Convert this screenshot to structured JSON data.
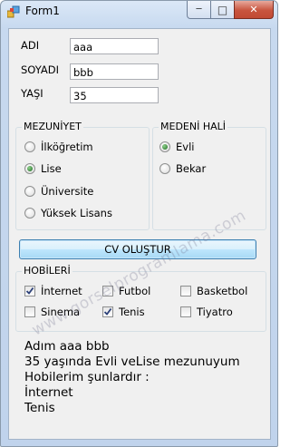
{
  "window": {
    "title": "Form1",
    "minimize_glyph": "─",
    "maximize_glyph": "□",
    "close_glyph": "✕"
  },
  "fields": {
    "adi": {
      "label": "ADI",
      "value": "aaa"
    },
    "soyadi": {
      "label": "SOYADI",
      "value": "bbb"
    },
    "yasi": {
      "label": "YAŞI",
      "value": "35"
    }
  },
  "mezuniyet": {
    "title": "MEZUNİYET",
    "options": [
      {
        "label": "İlköğretim",
        "selected": false
      },
      {
        "label": "Lise",
        "selected": true
      },
      {
        "label": "Üniversite",
        "selected": false
      },
      {
        "label": "Yüksek Lisans",
        "selected": false
      }
    ]
  },
  "medeni_hali": {
    "title": "MEDENİ HALİ",
    "options": [
      {
        "label": "Evli",
        "selected": true
      },
      {
        "label": "Bekar",
        "selected": false
      }
    ]
  },
  "cv_button": {
    "label": "CV OLUŞTUR"
  },
  "hobiler": {
    "title": "HOBİLERİ",
    "items": [
      {
        "label": "İnternet",
        "checked": true
      },
      {
        "label": "Futbol",
        "checked": false
      },
      {
        "label": "Basketbol",
        "checked": false
      },
      {
        "label": "Sinema",
        "checked": false
      },
      {
        "label": "Tenis",
        "checked": true
      },
      {
        "label": "Tiyatro",
        "checked": false
      }
    ]
  },
  "output": {
    "lines": [
      "Adım aaa bbb",
      "35 yaşında Evli veLise mezunuyum",
      "Hobilerim şunlardır :",
      "İnternet",
      "Tenis"
    ]
  },
  "watermark": "www.gorselprogramlama.com",
  "colors": {
    "radio_selected": "#2e8b2e",
    "button_border": "#3c7fb1",
    "close_button": "#c8543e"
  }
}
